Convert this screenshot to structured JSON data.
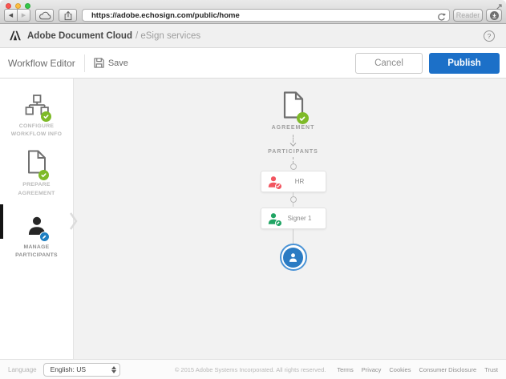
{
  "colors": {
    "publish_blue": "#1c70c8",
    "check_green": "#7eba28",
    "hr_red": "#f25560",
    "signer_green": "#1fa463",
    "badge_blue": "#1e7fc2",
    "node_blue": "#2b7bc3"
  },
  "browser": {
    "url": "https://adobe.echosign.com/public/home",
    "reader_label": "Reader"
  },
  "app_header": {
    "brand": "Adobe Document Cloud",
    "suffix": "/ eSign services",
    "help_glyph": "?"
  },
  "toolbar": {
    "title": "Workflow Editor",
    "save_label": "Save",
    "cancel_label": "Cancel",
    "publish_label": "Publish"
  },
  "sidebar": {
    "items": [
      {
        "label": "CONFIGURE\nWORKFLOW INFO",
        "status": "complete"
      },
      {
        "label": "PREPARE\nAGREEMENT",
        "status": "complete"
      },
      {
        "label": "MANAGE\nPARTICIPANTS",
        "status": "active"
      }
    ]
  },
  "canvas": {
    "agreement_label": "AGREEMENT",
    "participants_label": "PARTICIPANTS",
    "participants": [
      {
        "label": "HR",
        "badge": "check",
        "color": "#f25560"
      },
      {
        "label": "Signer 1",
        "badge": "pencil",
        "color": "#1fa463"
      }
    ]
  },
  "footer": {
    "language_label": "Language",
    "language_value": "English: US",
    "copyright": "© 2015 Adobe Systems Incorporated. All rights reserved.",
    "links": [
      "Terms",
      "Privacy",
      "Cookies",
      "Consumer Disclosure",
      "Trust"
    ]
  }
}
